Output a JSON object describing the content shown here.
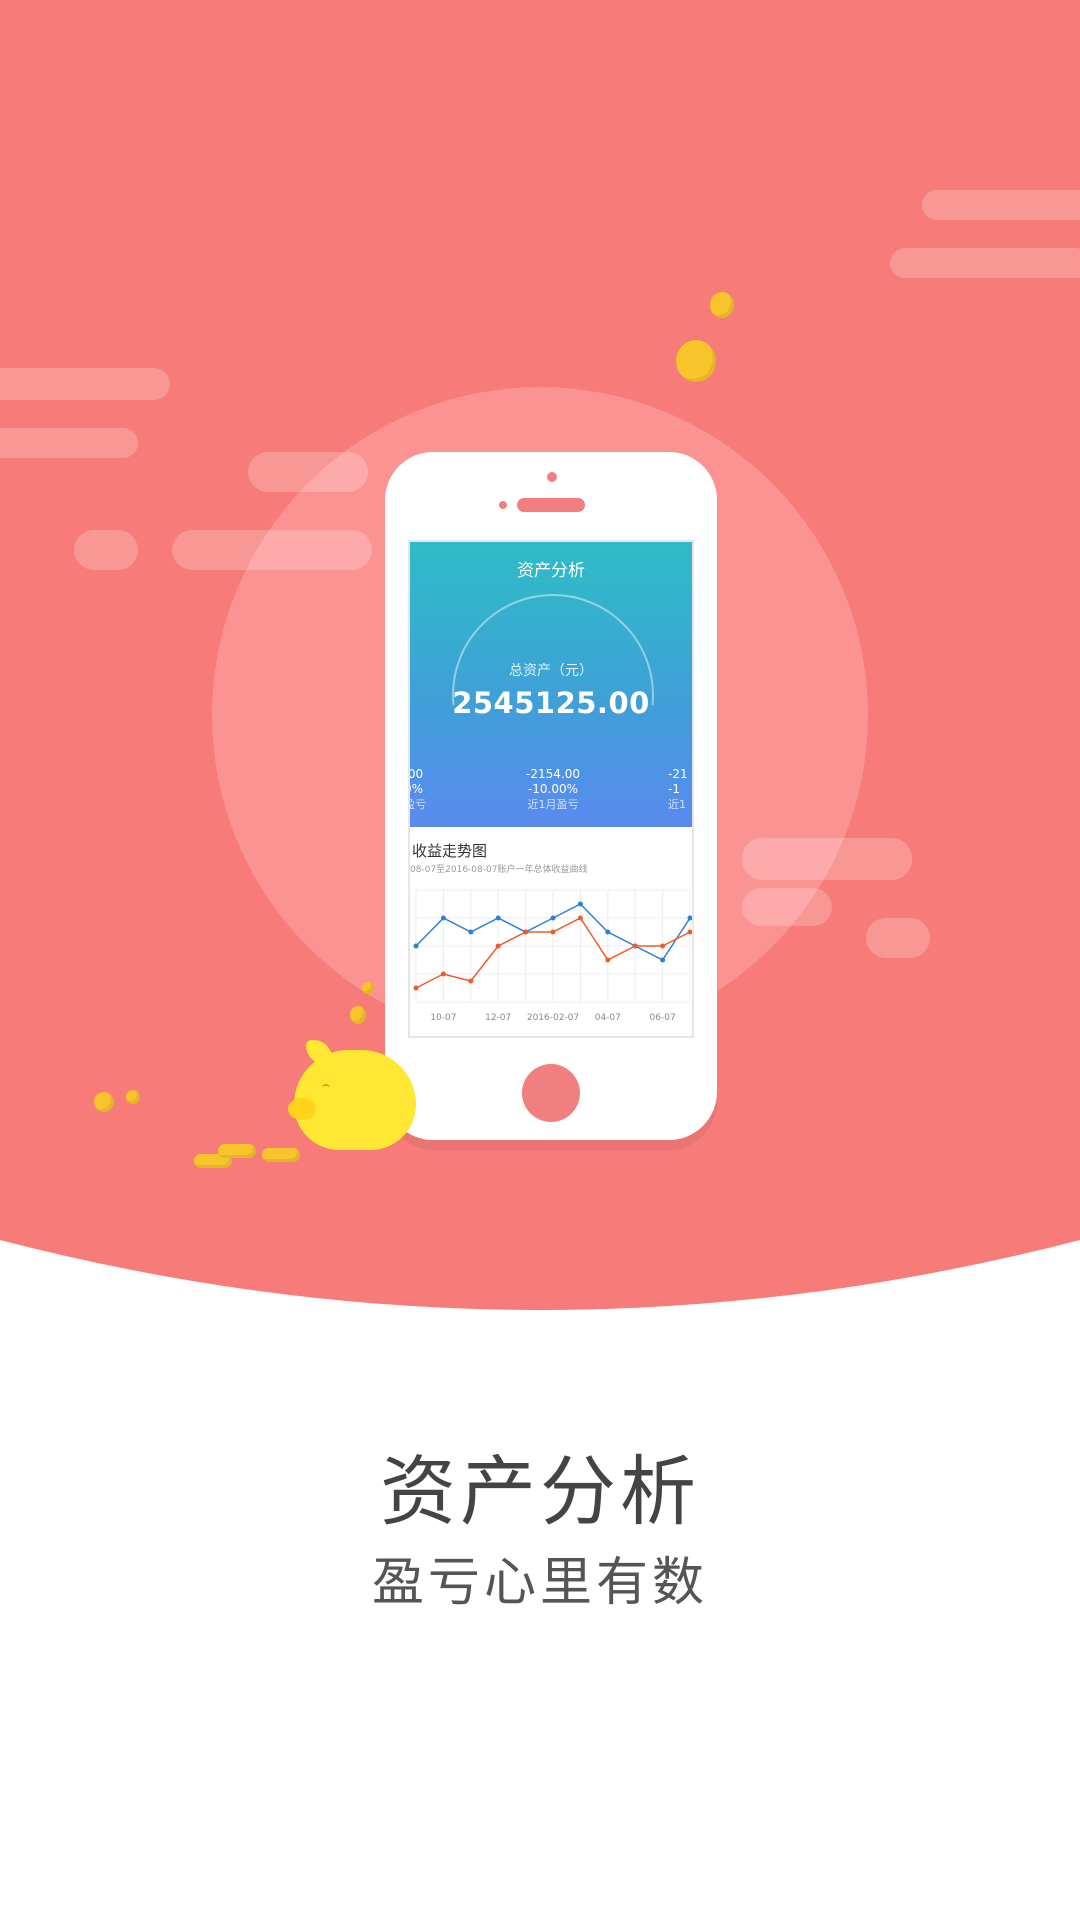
{
  "colors": {
    "hero_bg": "#f77b78",
    "screen_gradient_top": "#2ebdc6",
    "screen_gradient_bottom": "#5a8af0",
    "coin": "#f7c52b",
    "pig": "#ffe733"
  },
  "phone_screen": {
    "title": "资产分析",
    "asset_label": "总资产（元）",
    "asset_value": "2545125.00",
    "stats": [
      {
        "value": ".00",
        "percent": "0%",
        "caption": "盈亏"
      },
      {
        "value": "-2154.00",
        "percent": "-10.00%",
        "caption": "近1月盈亏"
      },
      {
        "value": "-21",
        "percent": "-1",
        "caption": "近1"
      }
    ],
    "chart_title": "收益走势图",
    "chart_subtitle": "08-07至2016-08-07账户一年总体收益曲线"
  },
  "chart_data": {
    "type": "line",
    "categories": [
      "10-07",
      "12-07",
      "2016-02-07",
      "04-07",
      "06-07"
    ],
    "x_points": 11,
    "series": [
      {
        "name": "",
        "color": "#2f7fd6",
        "values": [
          4,
          6,
          5,
          6,
          5,
          6,
          7,
          5,
          4,
          3,
          6
        ]
      },
      {
        "name": "",
        "color": "#ef5b2a",
        "values": [
          1,
          2,
          1.5,
          4,
          5,
          5,
          6,
          3,
          4,
          4,
          5
        ]
      }
    ],
    "ylim": [
      0,
      8
    ],
    "grid": true
  },
  "headline": "资产分析",
  "subline": "盈亏心里有数"
}
